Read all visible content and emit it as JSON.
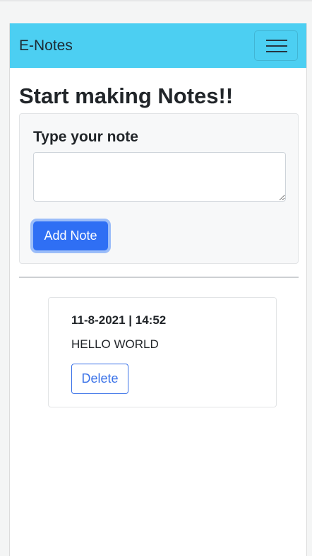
{
  "navbar": {
    "brand": "E-Notes",
    "toggler_icon": "hamburger-menu-icon"
  },
  "main": {
    "title": "Start making Notes!!",
    "form": {
      "label": "Type your note",
      "textarea_value": "",
      "add_button_label": "Add Note"
    },
    "notes": [
      {
        "date": "11-8-2021 | 14:52",
        "text": "HELLO WORLD",
        "delete_label": "Delete"
      }
    ]
  },
  "colors": {
    "navbar_bg": "#4ccff2",
    "primary": "#2f6ff4",
    "delete_outline": "#3a72e8"
  }
}
